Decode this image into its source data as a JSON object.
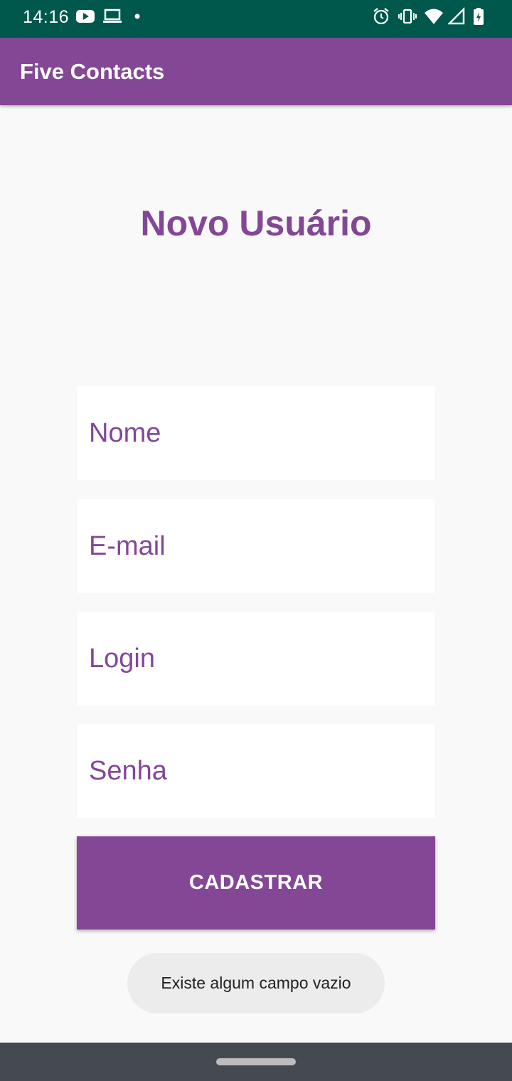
{
  "status_bar": {
    "time": "14:16",
    "left_icons": [
      "youtube-icon",
      "laptop-icon",
      "dot-icon"
    ],
    "right_icons": [
      "alarm-icon",
      "vibrate-icon",
      "wifi-icon",
      "signal-icon",
      "battery-charging-icon"
    ]
  },
  "app_bar": {
    "title": "Five Contacts"
  },
  "form": {
    "heading": "Novo Usuário",
    "name_placeholder": "Nome",
    "email_placeholder": "E-mail",
    "login_placeholder": "Login",
    "password_placeholder": "Senha",
    "submit_label": "CADASTRAR"
  },
  "toast": {
    "message": "Existe algum campo vazio"
  },
  "colors": {
    "status_bar": "#00574b",
    "primary": "#834796",
    "background": "#f9f9f9",
    "nav_bar": "#454a50"
  }
}
